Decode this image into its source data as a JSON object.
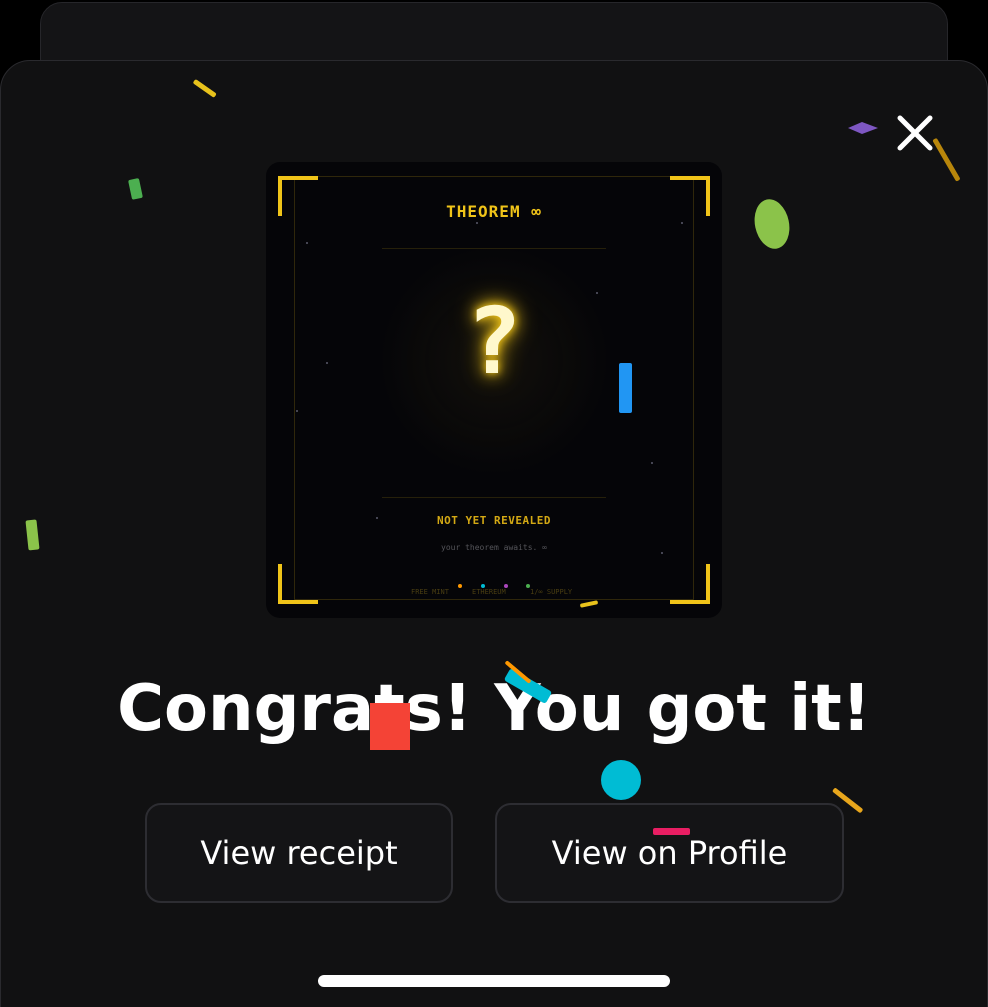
{
  "card": {
    "title": "THEOREM ∞",
    "mystery_symbol": "?",
    "status": "NOT YET REVEALED",
    "subtitle": "your theorem awaits. ∞",
    "footer_left": "FREE MINT",
    "footer_mid": "ETHEREUM",
    "footer_right": "1/∞ SUPPLY"
  },
  "headline": "Congrats! You got it!",
  "buttons": {
    "receipt_label": "View receipt",
    "profile_label": "View on Profile"
  },
  "colors": {
    "accent_gold": "#f0c419",
    "modal_bg": "#111112",
    "confetti": [
      "#e8c21c",
      "#4caf50",
      "#8bc34a",
      "#7e57c2",
      "#2196f3",
      "#00bcd4",
      "#f44336",
      "#ff9800",
      "#e91e63"
    ]
  },
  "icons": {
    "close": "close-icon",
    "confetti": "confetti-icon"
  }
}
